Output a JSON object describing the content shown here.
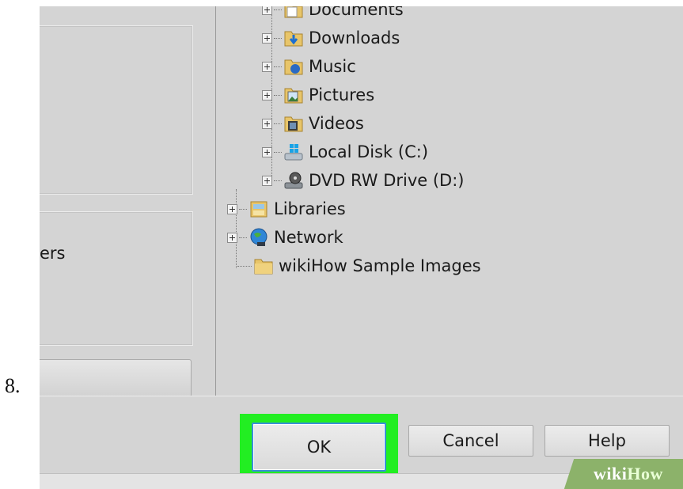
{
  "step": {
    "number": "8."
  },
  "left_panel": {
    "partial_label": "ers"
  },
  "tree": {
    "items": [
      {
        "label": "Documents",
        "icon": "documents-folder-icon",
        "expandable": true
      },
      {
        "label": "Downloads",
        "icon": "downloads-folder-icon",
        "expandable": true
      },
      {
        "label": "Music",
        "icon": "music-folder-icon",
        "expandable": true
      },
      {
        "label": "Pictures",
        "icon": "pictures-folder-icon",
        "expandable": true
      },
      {
        "label": "Videos",
        "icon": "videos-folder-icon",
        "expandable": true
      },
      {
        "label": "Local Disk (C:)",
        "icon": "local-disk-icon",
        "expandable": true
      },
      {
        "label": "DVD RW Drive (D:)",
        "icon": "dvd-drive-icon",
        "expandable": true
      },
      {
        "label": "Libraries",
        "icon": "libraries-icon",
        "expandable": true
      },
      {
        "label": "Network",
        "icon": "network-icon",
        "expandable": true
      },
      {
        "label": "wikiHow Sample Images",
        "icon": "folder-icon",
        "expandable": false
      }
    ]
  },
  "buttons": {
    "ok": "OK",
    "cancel": "Cancel",
    "help": "Help"
  },
  "highlight_color": "#22ee22",
  "watermark": {
    "part1": "wiki",
    "part2": "How"
  }
}
